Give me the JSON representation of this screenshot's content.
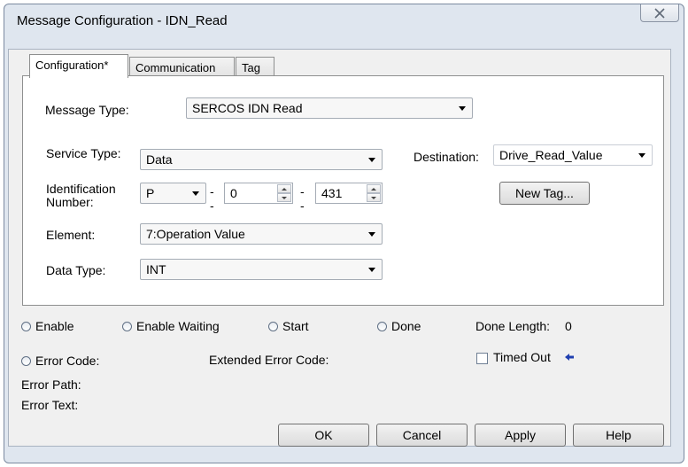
{
  "window": {
    "title": "Message Configuration - IDN_Read"
  },
  "tabs": [
    {
      "label": "Configuration*"
    },
    {
      "label": "Communication"
    },
    {
      "label": "Tag"
    }
  ],
  "config": {
    "message_type_label": "Message Type:",
    "message_type_value": "SERCOS IDN Read",
    "service_type_label": "Service Type:",
    "service_type_value": "Data",
    "identification_label": "Identification Number:",
    "id_prefix_value": "P",
    "id_separator": "--",
    "id_set_value": "0",
    "id_number_value": "431",
    "element_label": "Element:",
    "element_value": "7:Operation Value",
    "data_type_label": "Data Type:",
    "data_type_value": "INT",
    "destination_label": "Destination:",
    "destination_value": "Drive_Read_Value",
    "new_tag_label": "New Tag..."
  },
  "status": {
    "enable": "Enable",
    "enable_waiting": "Enable Waiting",
    "start": "Start",
    "done": "Done",
    "done_length_label": "Done Length:",
    "done_length_value": "0",
    "error_code": "Error Code:",
    "extended_error_code": "Extended Error Code:",
    "timed_out": "Timed Out",
    "error_path": "Error Path:",
    "error_text": "Error Text:"
  },
  "buttons": {
    "ok": "OK",
    "cancel": "Cancel",
    "apply": "Apply",
    "help": "Help"
  },
  "colors": {
    "window_bg": "#dfe6ef",
    "panel_bg": "#ffffff",
    "client_bg": "#f0f0f0",
    "arrow_blue": "#1f3fb0"
  }
}
